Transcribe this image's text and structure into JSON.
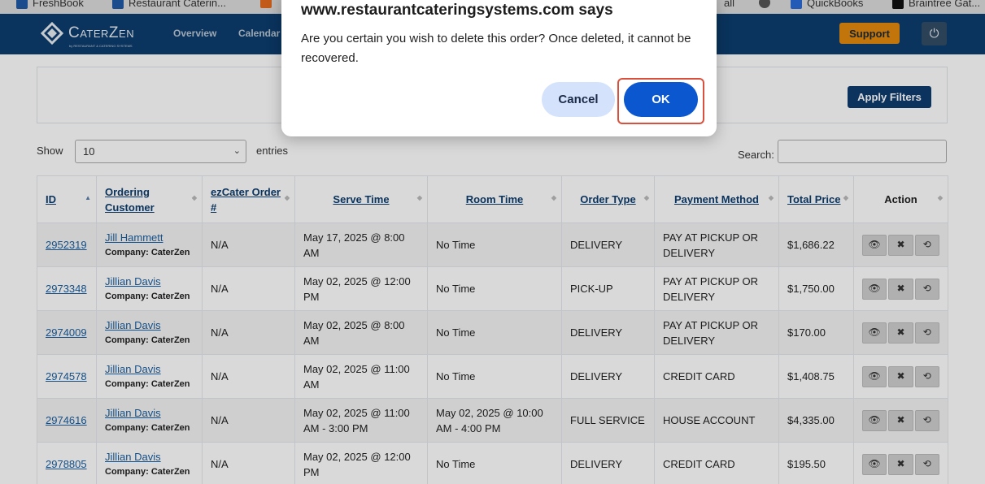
{
  "bookmarks": [
    {
      "label": "FreshBook",
      "color": "#1f5aa6"
    },
    {
      "label": "Restaurant Caterin...",
      "color": "#1f5aa6"
    },
    {
      "label": "",
      "color": "#e46b1f"
    },
    {
      "label": "all",
      "color": "#555555"
    },
    {
      "label": "QuickBooks",
      "color": "#2a6bd8"
    },
    {
      "label": "Braintree Gat...",
      "color": "#111111"
    }
  ],
  "brand": {
    "name": "CaterZen",
    "tagline": "by RESTAURANT & CATERING SYSTEMS"
  },
  "nav": {
    "overview": "Overview",
    "calendar": "Calendar"
  },
  "header": {
    "support": "Support",
    "power_icon": "power-icon"
  },
  "filters": {
    "apply": "Apply Filters"
  },
  "table_controls": {
    "show": "Show",
    "entries_value": "10",
    "entries": "entries",
    "search": "Search:"
  },
  "table": {
    "headers": [
      "ID",
      "Ordering Customer",
      "ezCater Order #",
      "Serve Time",
      "Room Time",
      "Order Type",
      "Payment Method",
      "Total Price",
      "Action"
    ],
    "rows": [
      {
        "id": "2952319",
        "customer": "Jill Hammett",
        "company": "Company: CaterZen",
        "ezcater": "N/A",
        "serve": "May 17, 2025 @ 8:00 AM",
        "room": "No Time",
        "type": "DELIVERY",
        "payment": "PAY AT PICKUP OR DELIVERY",
        "total": "$1,686.22"
      },
      {
        "id": "2973348",
        "customer": "Jillian Davis",
        "company": "Company: CaterZen",
        "ezcater": "N/A",
        "serve": "May 02, 2025 @ 12:00 PM",
        "room": "No Time",
        "type": "PICK-UP",
        "payment": "PAY AT PICKUP OR DELIVERY",
        "total": "$1,750.00"
      },
      {
        "id": "2974009",
        "customer": "Jillian Davis",
        "company": "Company: CaterZen",
        "ezcater": "N/A",
        "serve": "May 02, 2025 @ 8:00 AM",
        "room": "No Time",
        "type": "DELIVERY",
        "payment": "PAY AT PICKUP OR DELIVERY",
        "total": "$170.00"
      },
      {
        "id": "2974578",
        "customer": "Jillian Davis",
        "company": "Company: CaterZen",
        "ezcater": "N/A",
        "serve": "May 02, 2025 @ 11:00 AM",
        "room": "No Time",
        "type": "DELIVERY",
        "payment": "CREDIT CARD",
        "total": "$1,408.75"
      },
      {
        "id": "2974616",
        "customer": "Jillian Davis",
        "company": "Company: CaterZen",
        "ezcater": "N/A",
        "serve": "May 02, 2025 @ 11:00 AM - 3:00 PM",
        "room": "May 02, 2025 @ 10:00 AM - 4:00 PM",
        "type": "FULL SERVICE",
        "payment": "HOUSE ACCOUNT",
        "total": "$4,335.00"
      },
      {
        "id": "2978805",
        "customer": "Jillian Davis",
        "company": "Company: CaterZen",
        "ezcater": "N/A",
        "serve": "May 02, 2025 @ 12:00 PM",
        "room": "No Time",
        "type": "DELIVERY",
        "payment": "CREDIT CARD",
        "total": "$195.50"
      }
    ]
  },
  "dialog": {
    "title": "www.restaurantcateringsystems.com says",
    "message": "Are you certain you wish to delete this order?  Once deleted, it cannot be recovered.",
    "cancel": "Cancel",
    "ok": "OK"
  }
}
